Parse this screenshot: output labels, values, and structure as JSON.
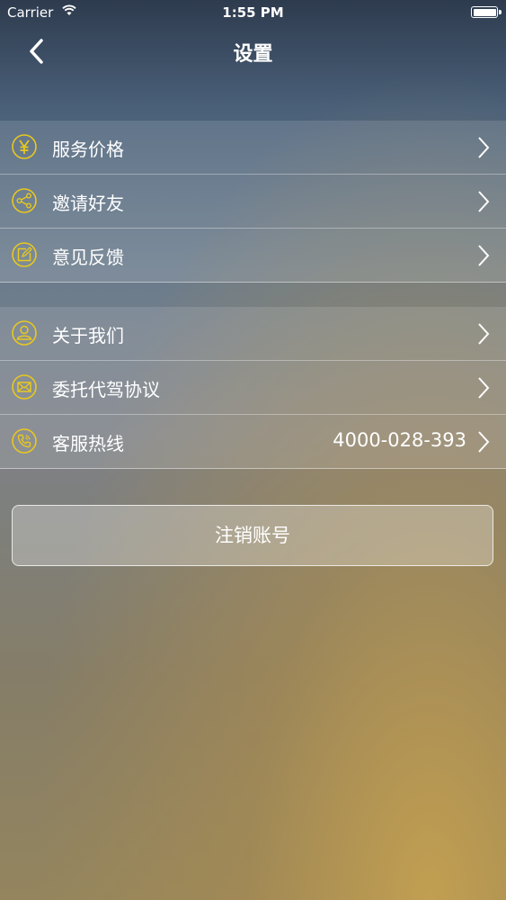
{
  "status": {
    "carrier": "Carrier",
    "time": "1:55 PM"
  },
  "nav": {
    "title": "设置"
  },
  "group1": [
    {
      "label": "服务价格",
      "icon": "yen-icon"
    },
    {
      "label": "邀请好友",
      "icon": "share-icon"
    },
    {
      "label": "意见反馈",
      "icon": "edit-icon"
    }
  ],
  "group2": [
    {
      "label": "关于我们",
      "icon": "user-icon"
    },
    {
      "label": "委托代驾协议",
      "icon": "mail-icon"
    },
    {
      "label": "客服热线",
      "icon": "phone-icon",
      "value": "4000-028-393"
    }
  ],
  "logout": {
    "label": "注销账号"
  },
  "colors": {
    "accent": "#e8c81e"
  }
}
